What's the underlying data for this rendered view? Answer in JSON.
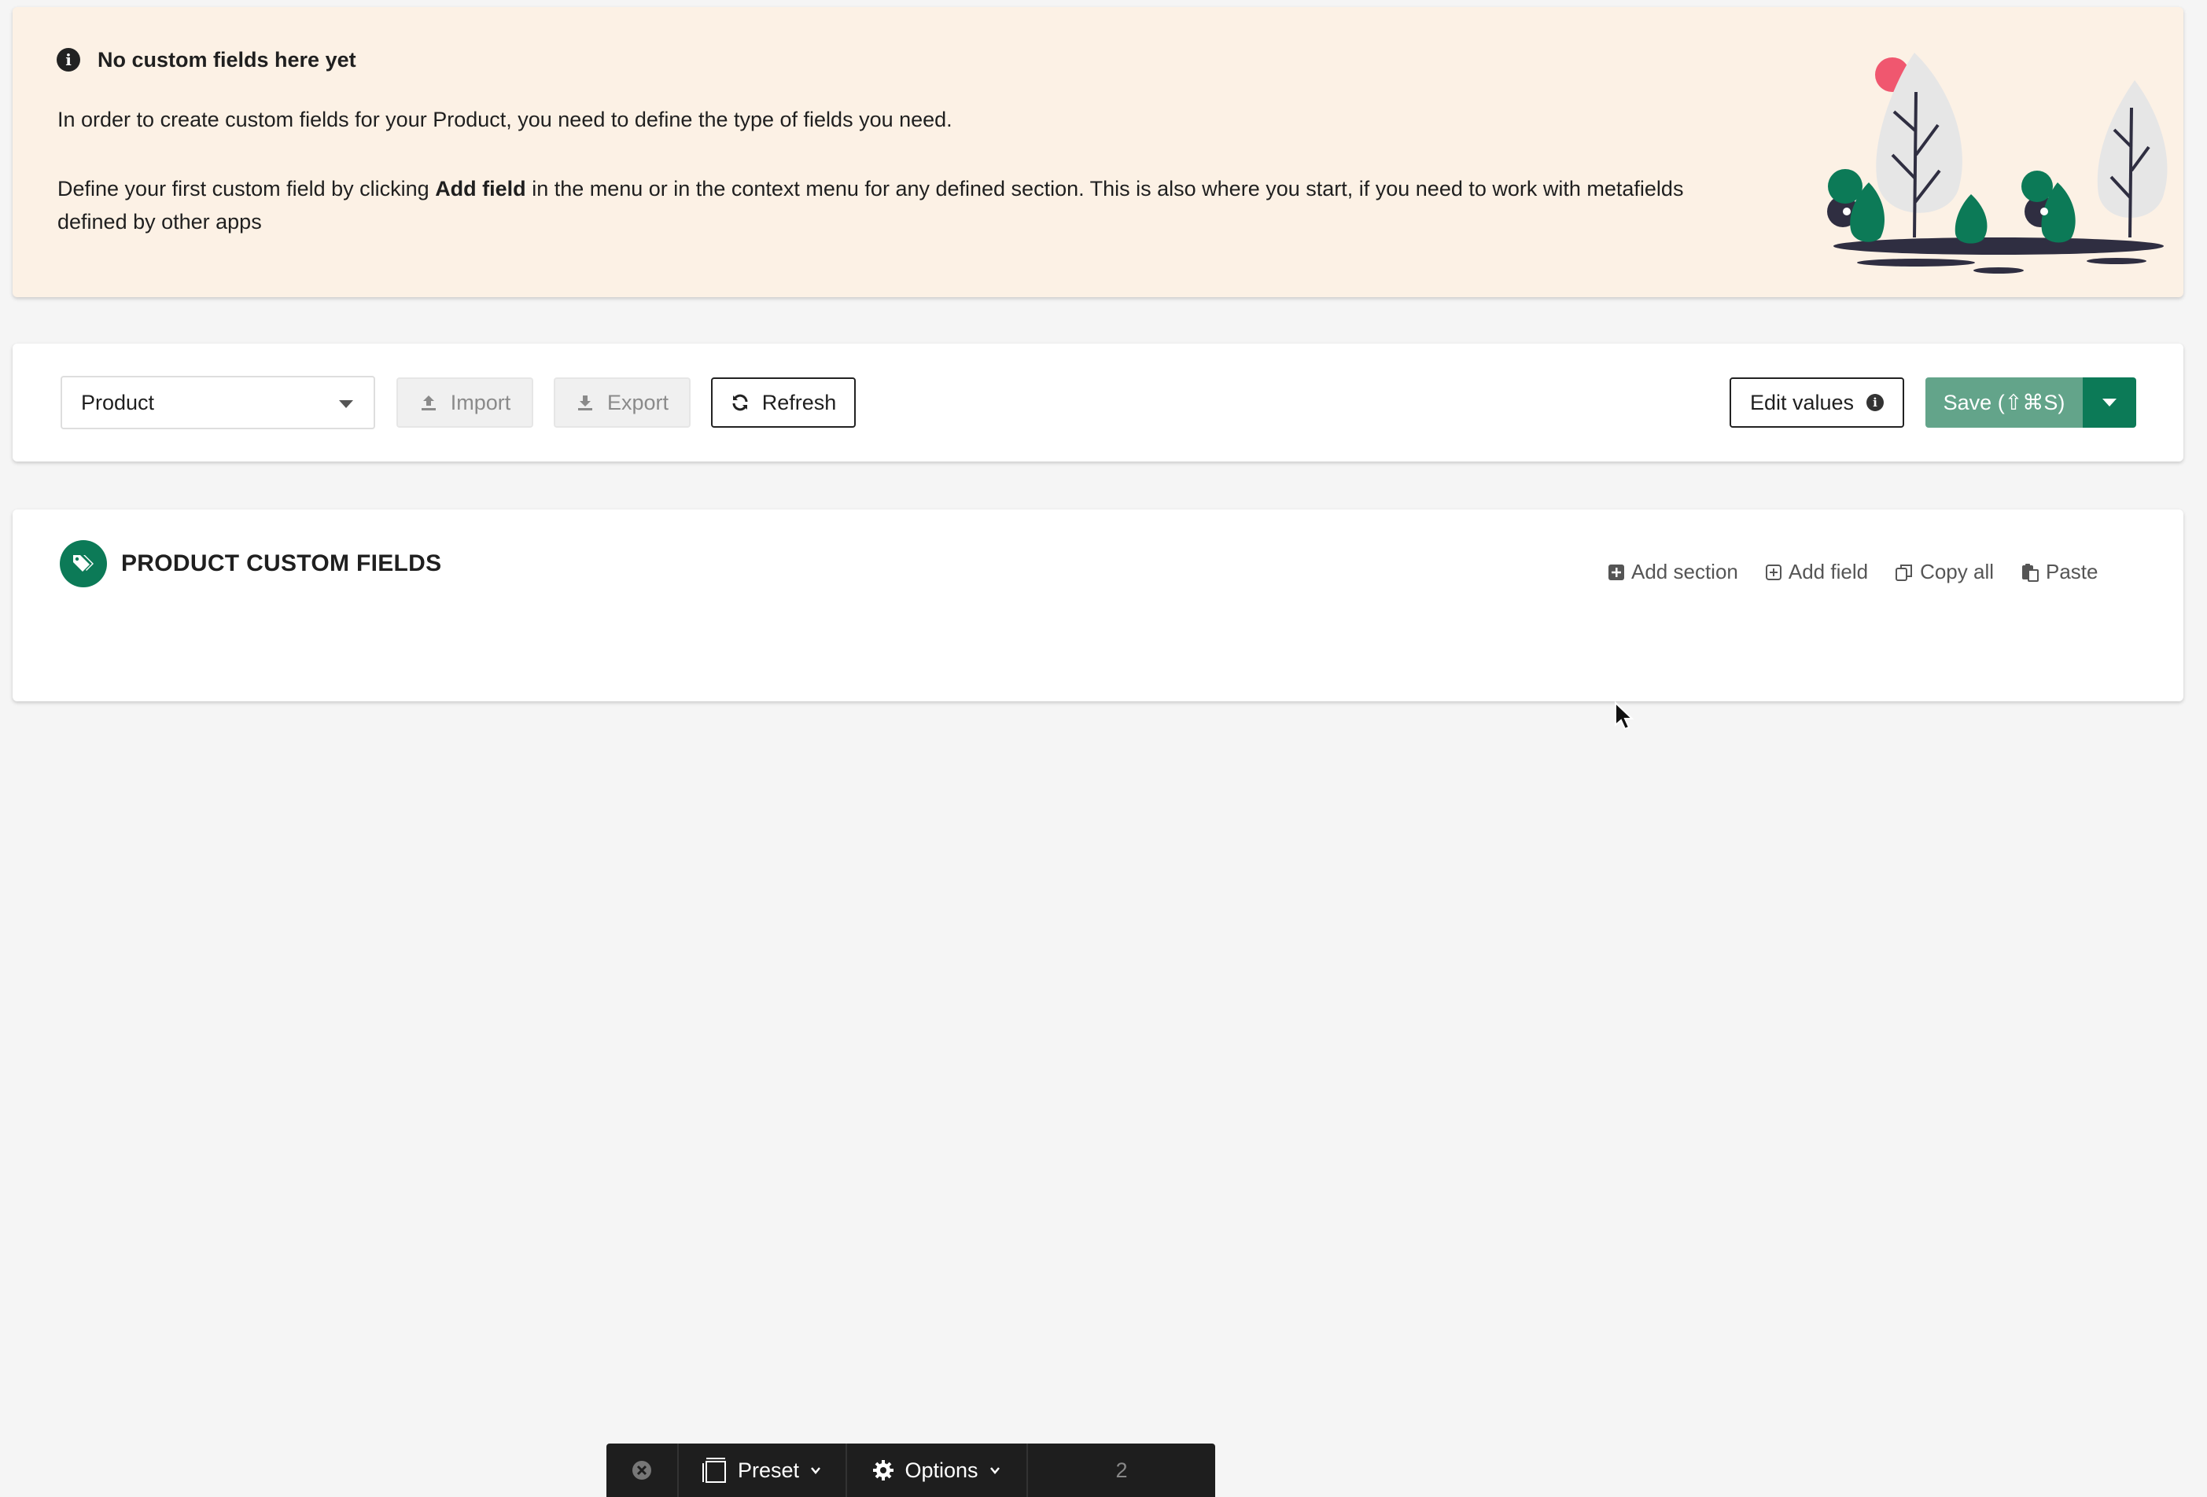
{
  "banner": {
    "title": "No custom fields here yet",
    "line1": "In order to create custom fields for your Product, you need to define the type of fields you need.",
    "line2_pre": "Define your first custom field by clicking ",
    "line2_bold": "Add field",
    "line2_post": " in the menu or in the context menu for any defined section. This is also where you start, if you need to work with metafields defined by other apps",
    "icon": "info-icon"
  },
  "toolbar": {
    "resource_select": "Product",
    "import_label": "Import",
    "export_label": "Export",
    "refresh_label": "Refresh",
    "edit_values_label": "Edit values",
    "save_label": "Save (⇧⌘S)"
  },
  "section": {
    "title": "PRODUCT CUSTOM FIELDS",
    "actions": {
      "add_section": "Add section",
      "add_field": "Add field",
      "copy_all": "Copy all",
      "paste": "Paste"
    }
  },
  "bottom_bar": {
    "preset_label": "Preset",
    "options_label": "Options",
    "page": "2"
  },
  "colors": {
    "accent": "#0c7a57",
    "save_bg": "#63a48a",
    "banner_bg": "#fcf1e5"
  }
}
